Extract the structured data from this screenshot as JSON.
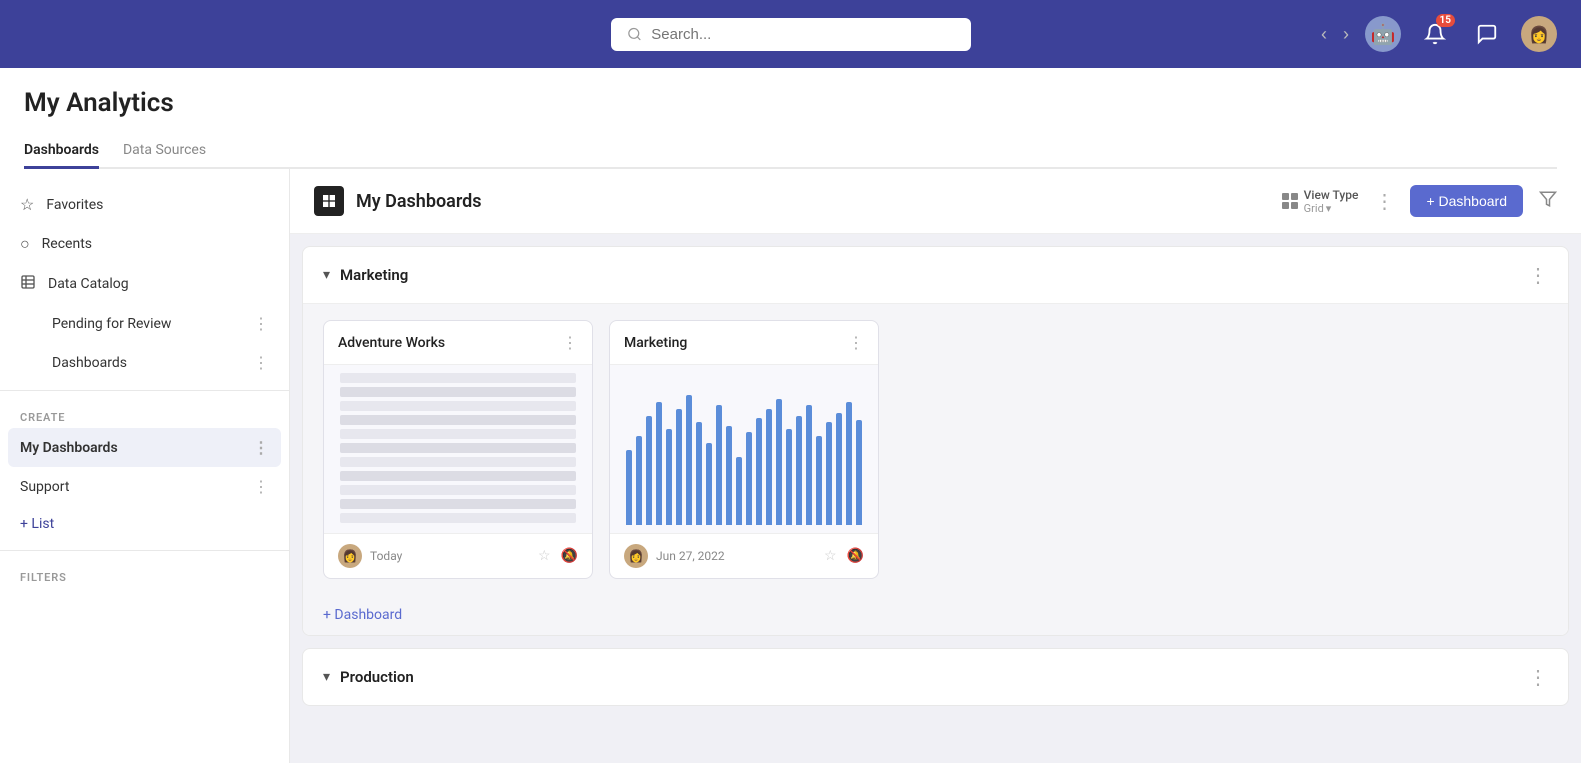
{
  "topbar": {
    "search_placeholder": "Search...",
    "notif_badge": "15",
    "back_arrow": "‹",
    "forward_arrow": "›"
  },
  "page": {
    "title": "My Analytics",
    "tabs": [
      {
        "label": "Dashboards",
        "active": true
      },
      {
        "label": "Data Sources",
        "active": false
      }
    ]
  },
  "sidebar": {
    "section_label_create": "CREATE",
    "section_label_filters": "FILTERS",
    "nav_items": [
      {
        "label": "Favorites",
        "icon": "★"
      },
      {
        "label": "Recents",
        "icon": "⏱"
      },
      {
        "label": "Data Catalog",
        "icon": "📊"
      }
    ],
    "sub_items": [
      {
        "label": "Pending for Review"
      },
      {
        "label": "Dashboards"
      }
    ],
    "create_items": [
      {
        "label": "My Dashboards",
        "active": true
      },
      {
        "label": "Support",
        "active": false
      }
    ],
    "add_list_label": "+ List"
  },
  "content": {
    "header_title": "My Dashboards",
    "view_type_label": "View Type",
    "view_type_sub": "Grid",
    "add_dashboard_label": "+ Dashboard",
    "sections": [
      {
        "title": "Marketing",
        "cards": [
          {
            "title": "Adventure Works",
            "type": "table",
            "date": "Today"
          },
          {
            "title": "Marketing",
            "type": "chart",
            "date": "Jun 27, 2022",
            "bars": [
              55,
              65,
              80,
              90,
              70,
              85,
              95,
              75,
              60,
              88,
              72,
              50,
              68,
              78,
              85,
              92,
              70,
              80,
              88,
              65,
              75,
              82,
              90,
              77
            ]
          }
        ],
        "add_label": "+ Dashboard"
      }
    ],
    "production_section_title": "Production"
  }
}
